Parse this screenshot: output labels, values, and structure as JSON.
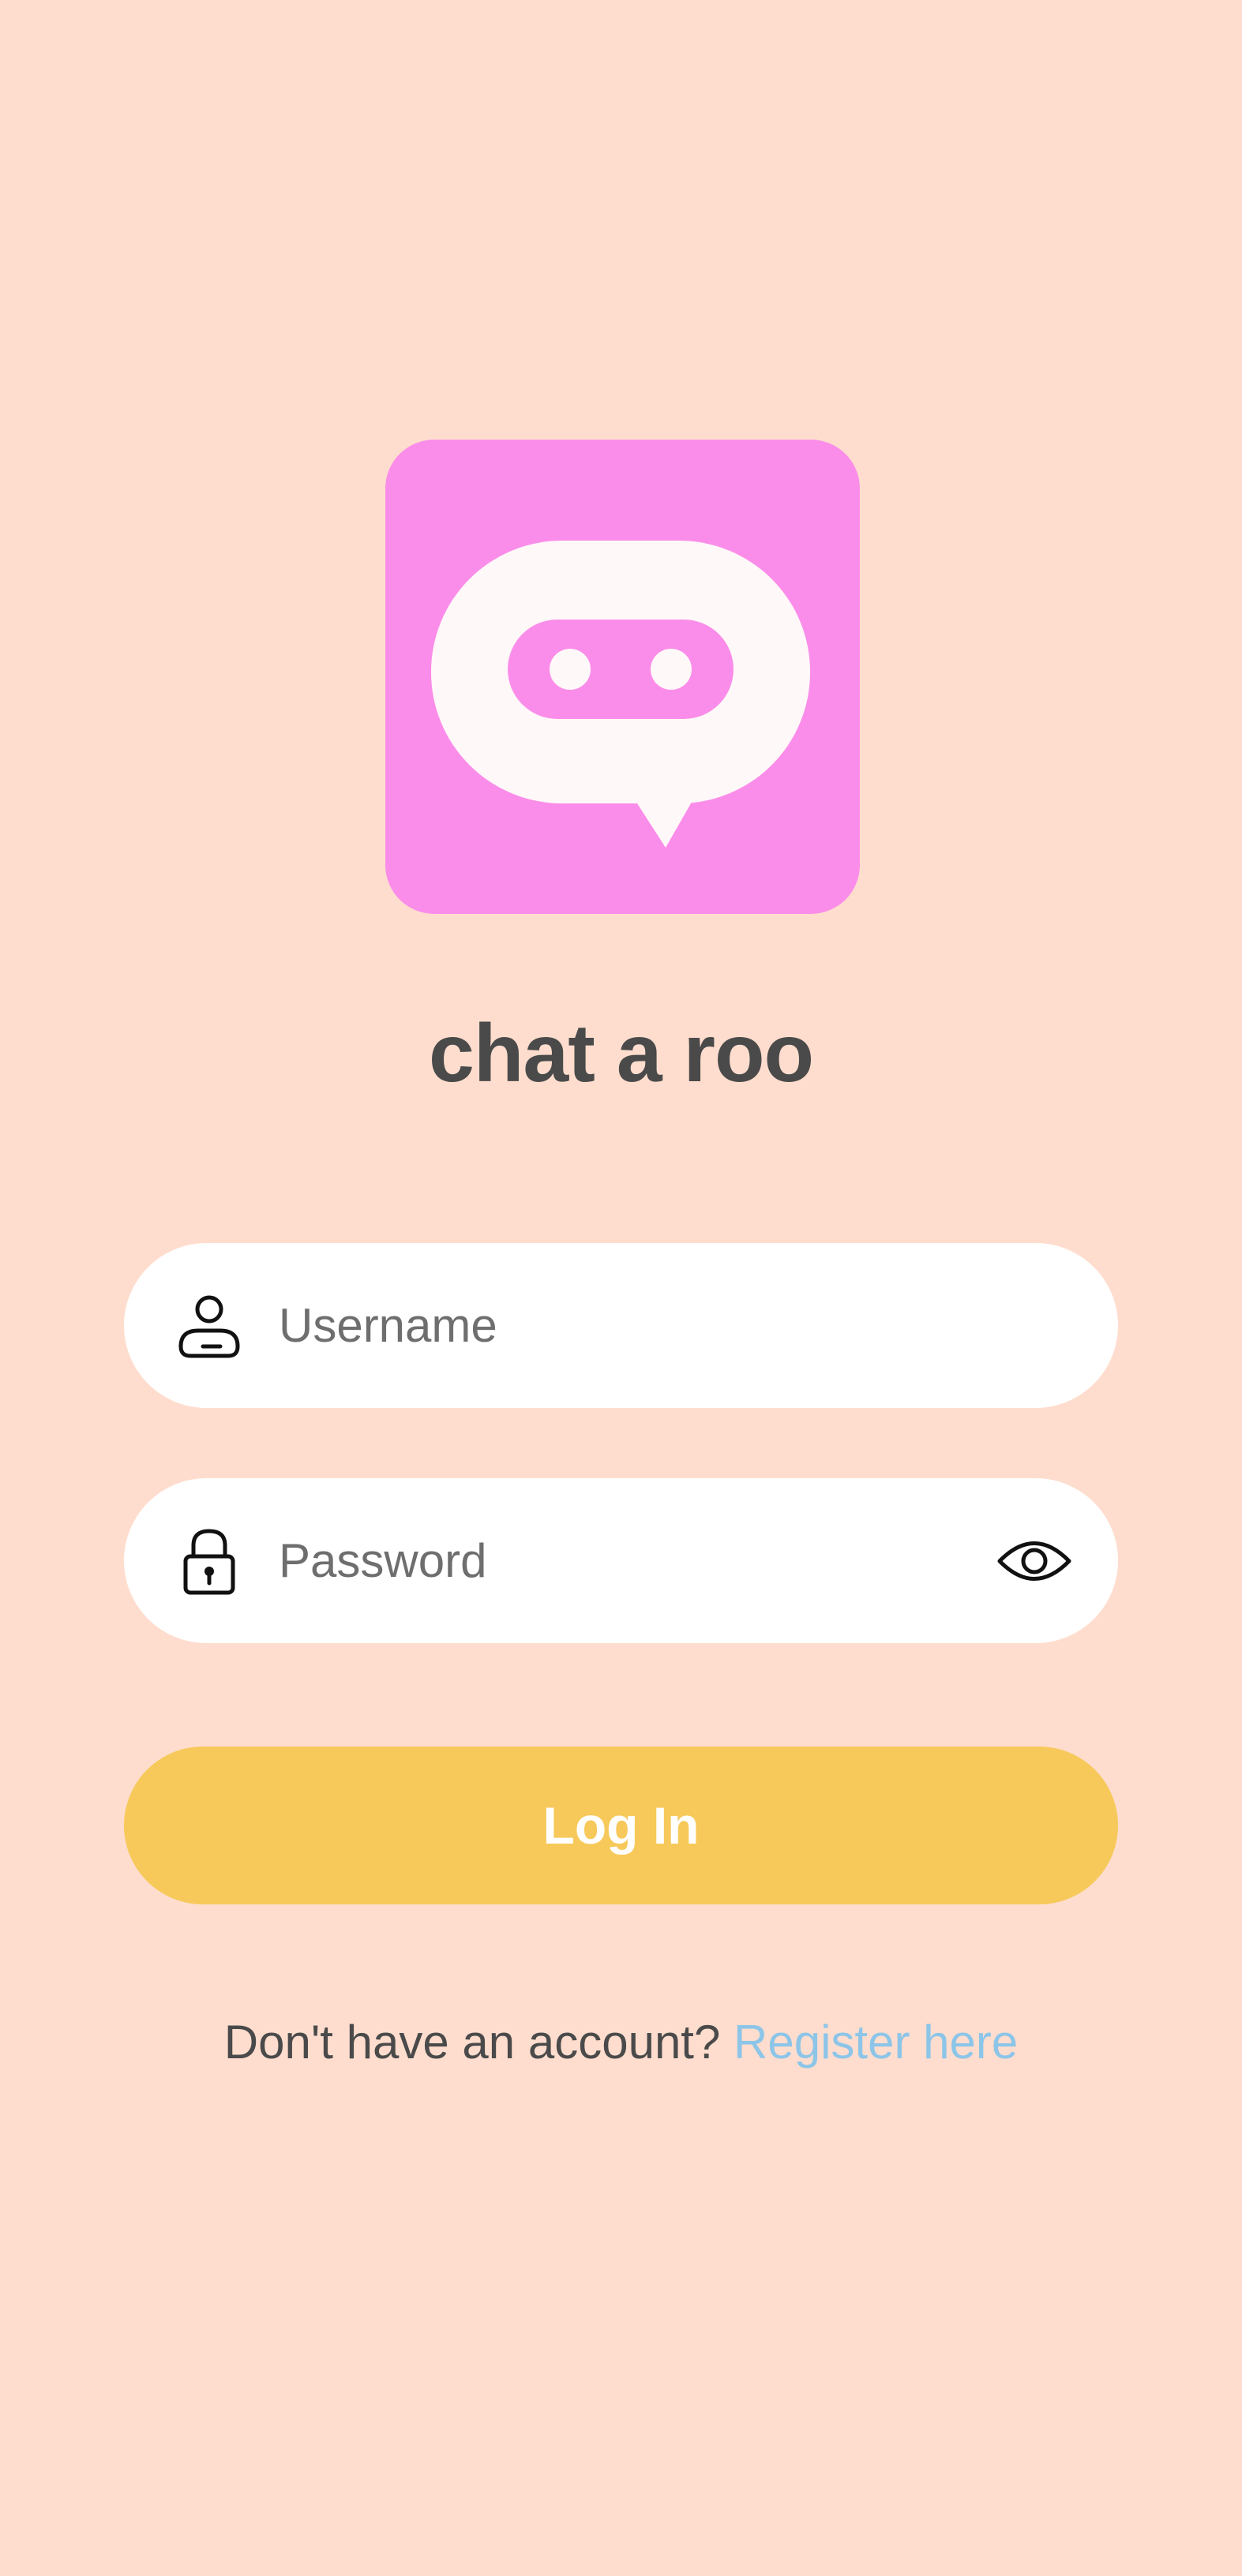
{
  "app": {
    "name": "chat a roo"
  },
  "login_form": {
    "username": {
      "value": "",
      "placeholder": "Username",
      "icon": "user-icon"
    },
    "password": {
      "value": "",
      "placeholder": "Password",
      "icon": "lock-icon",
      "toggle_icon": "eye-icon"
    },
    "submit_label": "Log In"
  },
  "register": {
    "prompt": "Don't have an account?",
    "link_label": "Register here"
  },
  "colors": {
    "background": "#FFDDCE",
    "logo_background": "#FB8DEA",
    "logo_bubble": "#FFF8F8",
    "primary_button": "#F6C95A",
    "link": "#8CC5E8",
    "text": "#4A4A4A"
  }
}
